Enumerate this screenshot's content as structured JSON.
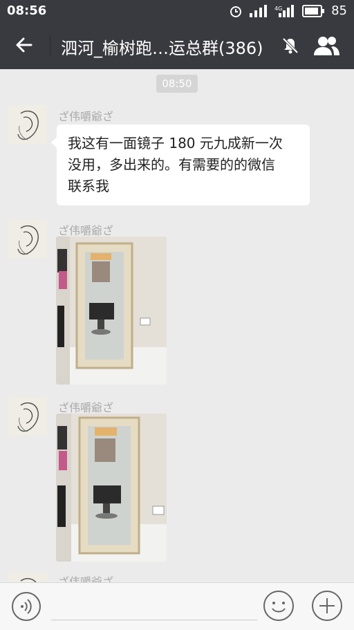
{
  "status": {
    "time": "08:56",
    "battery": "85",
    "net_label": "4G"
  },
  "header": {
    "title": "泗河_榆树跑…运总群(386)"
  },
  "chat": {
    "timestamp": "08:50",
    "messages": [
      {
        "sender": "ざ伟嚼爺ざ",
        "text_lines": [
          "我这有一面镜子 180 元九成新一次",
          "没用，多出来的。有需要的的微信",
          "联系我"
        ]
      },
      {
        "sender": "ざ伟嚼爺ざ"
      },
      {
        "sender": "ざ伟嚼爺ざ"
      },
      {
        "sender": "ざ伟嚼爺ざ"
      }
    ]
  },
  "colors": {
    "bar": "#393a3f",
    "chat_bg": "#ebebeb",
    "bubble": "#ffffff"
  }
}
